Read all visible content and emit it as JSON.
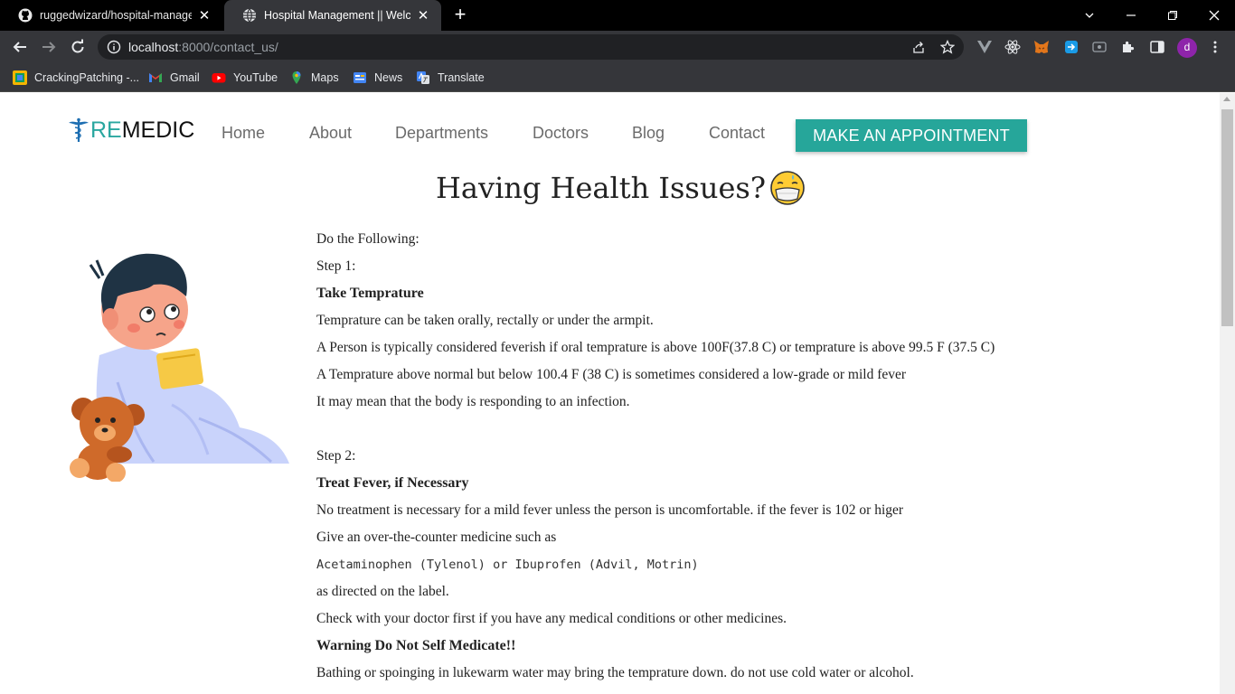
{
  "browser": {
    "tabs": [
      {
        "title": "ruggedwizard/hospital-managen",
        "favicon": "github-icon",
        "active": false
      },
      {
        "title": "Hospital Management || Welcom",
        "favicon": "globe-icon",
        "active": true
      }
    ],
    "url_host": "localhost",
    "url_rest": ":8000/contact_us/",
    "profile_initial": "d",
    "bookmarks": [
      {
        "label": "CrackingPatching -...",
        "icon": "crackingpatching-icon"
      },
      {
        "label": "Gmail",
        "icon": "gmail-icon"
      },
      {
        "label": "YouTube",
        "icon": "youtube-icon"
      },
      {
        "label": "Maps",
        "icon": "maps-icon"
      },
      {
        "label": "News",
        "icon": "news-icon"
      },
      {
        "label": "Translate",
        "icon": "translate-icon"
      }
    ]
  },
  "site": {
    "logo_re": "RE",
    "logo_medic": "MEDIC",
    "nav": [
      "Home",
      "About",
      "Departments",
      "Doctors",
      "Blog",
      "Contact"
    ],
    "cta": "MAKE AN APPOINTMENT",
    "accent_color": "#26a69a"
  },
  "main": {
    "heading": "Having Health Issues?",
    "lines": [
      "Do the Following:",
      "Step 1:",
      "Take Temprature",
      "Temprature can be taken orally, rectally or under the armpit.",
      "A Person is typically considered feverish if oral temprature is above 100F(37.8 C) or temprature is above 99.5 F (37.5 C)",
      "A Temprature above normal but below 100.4 F (38 C) is sometimes considered a low-grade or mild fever",
      "It may mean that the body is responding to an infection.",
      "",
      "Step 2:",
      "Treat Fever, if Necessary",
      "No treatment is necessary for a mild fever unless the person is uncomfortable. if the fever is 102 or higer",
      "Give an over-the-counter medicine such as",
      "Acetaminophen (Tylenol) or Ibuprofen (Advil, Motrin)",
      "as directed on the label.",
      "Check with your doctor first if you have any medical conditions or other medicines.",
      "Warning Do Not Self Medicate!!",
      "Bathing or spoinging in lukewarm water may bring the temprature down. do not use cold water or alcohol."
    ]
  }
}
